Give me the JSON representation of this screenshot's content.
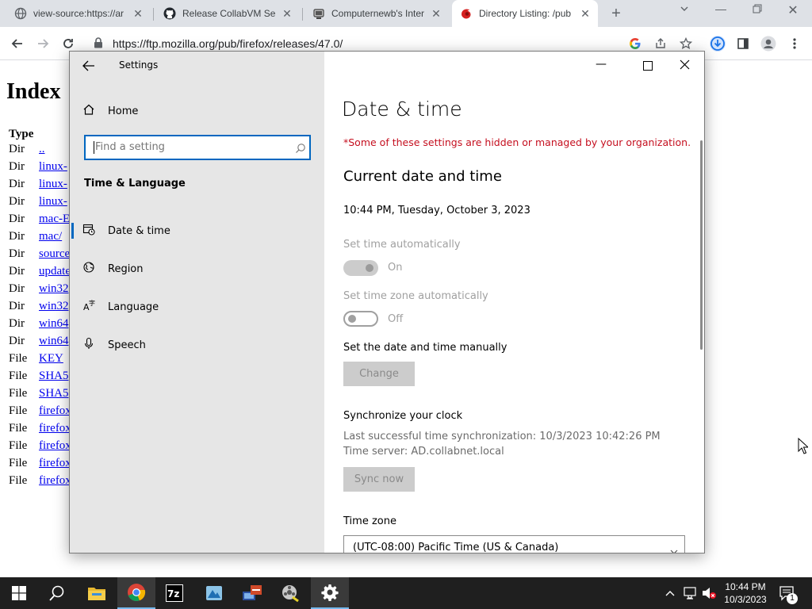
{
  "browser": {
    "tabs": [
      {
        "title": "view-source:https://ar",
        "icon": "globe-icon"
      },
      {
        "title": "Release CollabVM Ser",
        "icon": "github-icon"
      },
      {
        "title": "Computernewb's Inter",
        "icon": "computernewb-icon"
      },
      {
        "title": "Directory Listing: /pub",
        "icon": "firefox-icon",
        "active": true
      }
    ],
    "new_tab_label": "+",
    "url": "https://ftp.mozilla.org/pub/firefox/releases/47.0/"
  },
  "page": {
    "heading": "Index",
    "col_type": "Type",
    "rows": [
      {
        "type": "Dir",
        "name": ".."
      },
      {
        "type": "Dir",
        "name": "linux-"
      },
      {
        "type": "Dir",
        "name": "linux-"
      },
      {
        "type": "Dir",
        "name": "linux-"
      },
      {
        "type": "Dir",
        "name": "mac-E"
      },
      {
        "type": "Dir",
        "name": "mac/"
      },
      {
        "type": "Dir",
        "name": "source"
      },
      {
        "type": "Dir",
        "name": "update"
      },
      {
        "type": "Dir",
        "name": "win32"
      },
      {
        "type": "Dir",
        "name": "win32"
      },
      {
        "type": "Dir",
        "name": "win64"
      },
      {
        "type": "Dir",
        "name": "win64"
      },
      {
        "type": "File",
        "name": "KEY"
      },
      {
        "type": "File",
        "name": "SHA5"
      },
      {
        "type": "File",
        "name": "SHA5"
      },
      {
        "type": "File",
        "name": "firefox"
      },
      {
        "type": "File",
        "name": "firefox"
      },
      {
        "type": "File",
        "name": "firefox"
      },
      {
        "type": "File",
        "name": "firefox"
      },
      {
        "type": "File",
        "name": "firefox"
      }
    ]
  },
  "settings": {
    "window_title": "Settings",
    "home_label": "Home",
    "search_placeholder": "Find a setting",
    "section_label": "Time & Language",
    "nav": [
      {
        "label": "Date & time",
        "icon": "calendar-clock-icon",
        "selected": true
      },
      {
        "label": "Region",
        "icon": "globe-icon"
      },
      {
        "label": "Language",
        "icon": "language-icon"
      },
      {
        "label": "Speech",
        "icon": "microphone-icon"
      }
    ],
    "page_title": "Date & time",
    "managed_notice": "*Some of these settings are hidden or managed by your organization.",
    "current_heading": "Current date and time",
    "current_datetime": "10:44 PM, Tuesday, October 3, 2023",
    "auto_time_label": "Set time automatically",
    "auto_time_state": "On",
    "auto_tz_label": "Set time zone automatically",
    "auto_tz_state": "Off",
    "manual_label": "Set the date and time manually",
    "change_button": "Change",
    "sync_heading": "Synchronize your clock",
    "sync_last": "Last successful time synchronization: 10/3/2023 10:42:26 PM",
    "sync_server": "Time server: AD.collabnet.local",
    "sync_button": "Sync now",
    "tz_label": "Time zone",
    "tz_value": "(UTC-08:00) Pacific Time (US & Canada)"
  },
  "taskbar": {
    "clock_time": "10:44 PM",
    "clock_date": "10/3/2023",
    "notification_count": "1"
  },
  "colors": {
    "accent": "#0067c0",
    "notice_red": "#c50f1f",
    "taskbar": "#1f1f1f"
  }
}
